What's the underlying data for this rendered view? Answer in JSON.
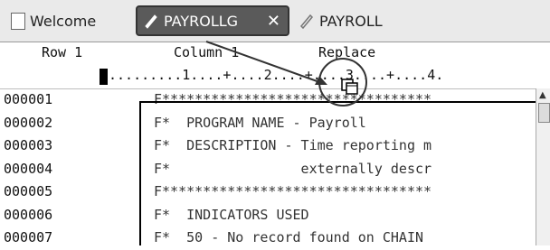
{
  "tabs": {
    "welcome": "Welcome",
    "active": "PAYROLLG",
    "active_close": "✕",
    "other": "PAYROLL"
  },
  "header": {
    "row": "Row 1",
    "column": "Column 1",
    "mode": "Replace"
  },
  "ruler": ".........1....+....2....+....3....+....4.",
  "lines": [
    {
      "num": "000001",
      "text": "F*********************************"
    },
    {
      "num": "000002",
      "text": "F*  PROGRAM NAME - Payroll"
    },
    {
      "num": "000003",
      "text": "F*  DESCRIPTION - Time reporting m"
    },
    {
      "num": "000004",
      "text": "F*                externally descr"
    },
    {
      "num": "000005",
      "text": "F*********************************"
    },
    {
      "num": "000006",
      "text": "F*  INDICATORS USED"
    },
    {
      "num": "000007",
      "text": "F*  50 - No record found on CHAIN"
    }
  ],
  "colors": {
    "active_tab": "#5a5a5a",
    "tabbar": "#eaeaea"
  }
}
